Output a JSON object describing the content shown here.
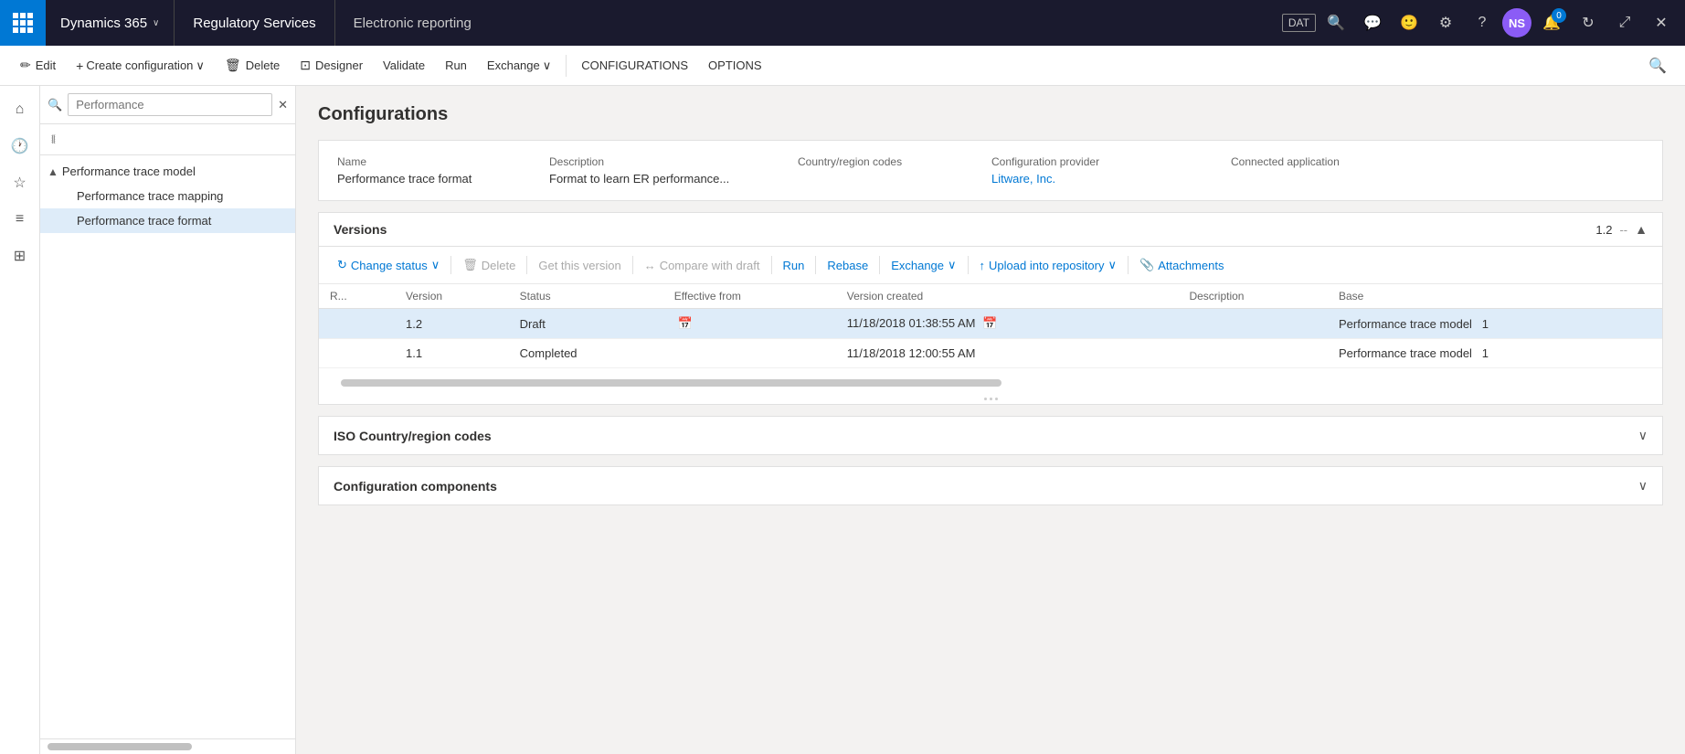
{
  "topnav": {
    "appGrid": "⊞",
    "dynamicsTitle": "Dynamics 365",
    "dynamicsChevron": "˅",
    "regServices": "Regulatory Services",
    "moduleTitle": "Electronic reporting",
    "datLabel": "DAT",
    "nsLabel": "NS",
    "notificationCount": "0"
  },
  "toolbar": {
    "editLabel": "Edit",
    "createConfigLabel": "Create configuration",
    "deleteLabel": "Delete",
    "designerLabel": "Designer",
    "validateLabel": "Validate",
    "runLabel": "Run",
    "exchangeLabel": "Exchange",
    "configurationsLabel": "CONFIGURATIONS",
    "optionsLabel": "OPTIONS"
  },
  "sidebar": {
    "searchPlaceholder": "Performance",
    "filterTooltip": "Filter",
    "treeItems": [
      {
        "id": "performance-trace-model",
        "label": "Performance trace model",
        "level": 0,
        "expanded": true,
        "hasChildren": true
      },
      {
        "id": "performance-trace-mapping",
        "label": "Performance trace mapping",
        "level": 1,
        "expanded": false,
        "hasChildren": false
      },
      {
        "id": "performance-trace-format",
        "label": "Performance trace format",
        "level": 1,
        "expanded": false,
        "hasChildren": false,
        "selected": true
      }
    ]
  },
  "main": {
    "pageTitle": "Configurations",
    "configHeader": {
      "columns": [
        {
          "header": "Name",
          "value": "Performance trace format",
          "isLink": false
        },
        {
          "header": "Description",
          "value": "Format to learn ER performance...",
          "isLink": false
        },
        {
          "header": "Country/region codes",
          "value": "",
          "isLink": false
        },
        {
          "header": "Configuration provider",
          "value": "Litware, Inc.",
          "isLink": true
        },
        {
          "header": "Connected application",
          "value": "",
          "isLink": false
        }
      ]
    },
    "versionsPanel": {
      "title": "Versions",
      "versionInfo": "1.2",
      "versionSep": "--",
      "toolbar": [
        {
          "id": "change-status",
          "label": "Change status",
          "hasChevron": true,
          "isLink": true,
          "disabled": false
        },
        {
          "id": "delete",
          "label": "Delete",
          "disabled": true,
          "icon": "🗑"
        },
        {
          "id": "get-version",
          "label": "Get this version",
          "disabled": true
        },
        {
          "id": "compare-draft",
          "label": "Compare with draft",
          "disabled": true
        },
        {
          "id": "run",
          "label": "Run",
          "isLink": true,
          "disabled": false
        },
        {
          "id": "rebase",
          "label": "Rebase",
          "isLink": true,
          "disabled": false
        },
        {
          "id": "exchange",
          "label": "Exchange",
          "hasChevron": true,
          "isLink": true,
          "disabled": false
        },
        {
          "id": "upload-repo",
          "label": "Upload into repository",
          "hasChevron": true,
          "isLink": true,
          "disabled": false
        },
        {
          "id": "attachments",
          "label": "Attachments",
          "isLink": true,
          "disabled": false,
          "icon": "📎"
        }
      ],
      "tableHeaders": [
        {
          "id": "row-num",
          "label": "R..."
        },
        {
          "id": "version",
          "label": "Version"
        },
        {
          "id": "status",
          "label": "Status"
        },
        {
          "id": "effective-from",
          "label": "Effective from"
        },
        {
          "id": "version-created",
          "label": "Version created"
        },
        {
          "id": "description",
          "label": "Description"
        },
        {
          "id": "base",
          "label": "Base"
        }
      ],
      "rows": [
        {
          "rowNum": "",
          "version": "1.2",
          "status": "Draft",
          "effectiveFrom": "",
          "versionCreated": "11/18/2018 01:38:55 AM",
          "description": "",
          "base": "Performance trace model",
          "baseNum": "1",
          "selected": true,
          "isLink": true
        },
        {
          "rowNum": "",
          "version": "1.1",
          "status": "Completed",
          "effectiveFrom": "",
          "versionCreated": "11/18/2018 12:00:55 AM",
          "description": "",
          "base": "Performance trace model",
          "baseNum": "1",
          "selected": false,
          "isLink": false
        }
      ]
    },
    "isoPanel": {
      "title": "ISO Country/region codes"
    },
    "componentsPanel": {
      "title": "Configuration components"
    }
  }
}
